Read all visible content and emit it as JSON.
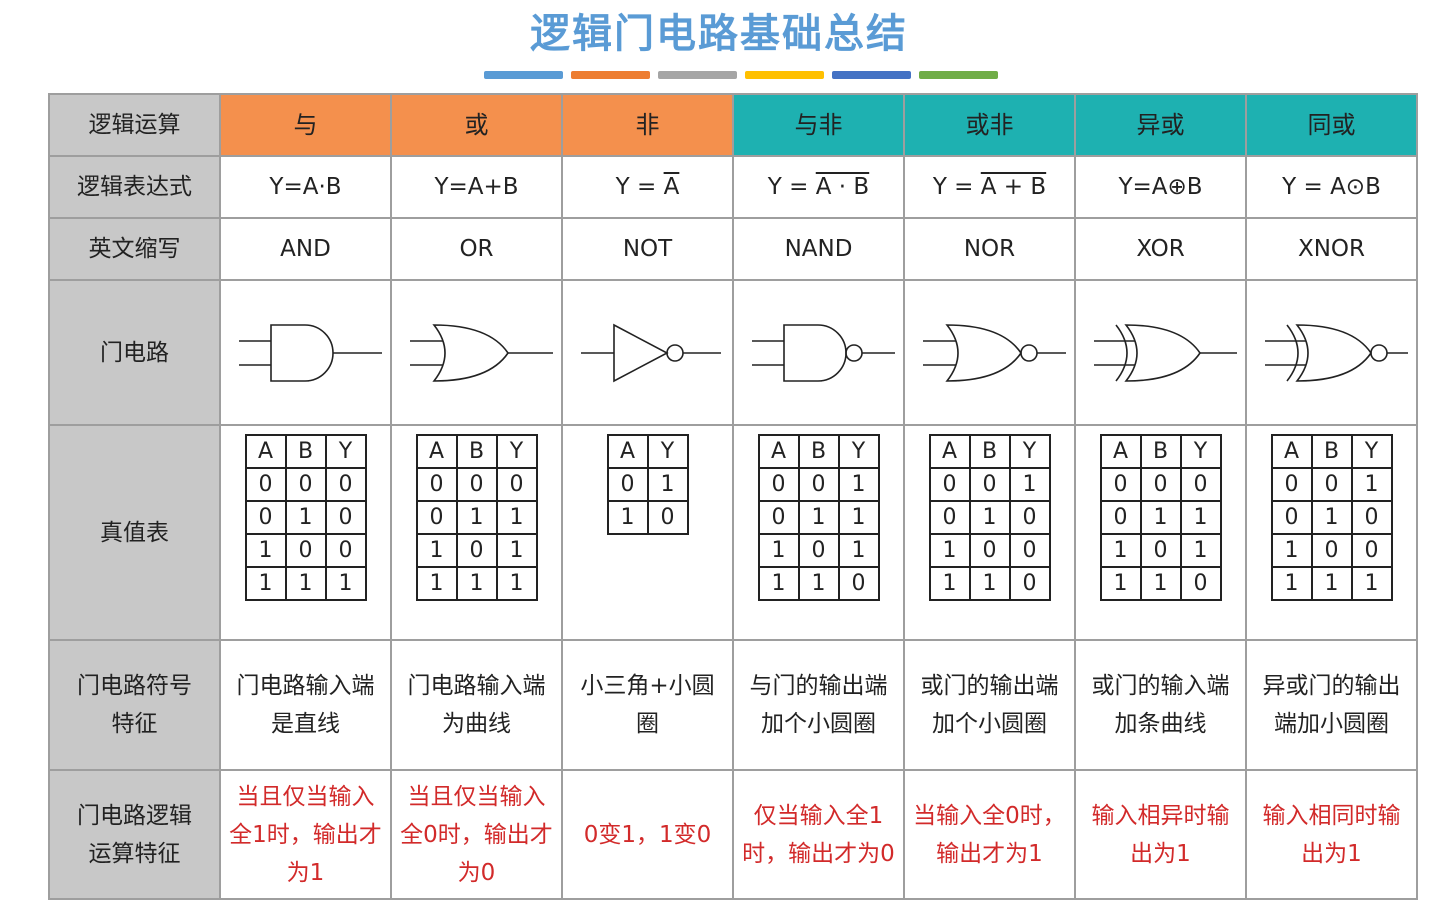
{
  "title": "逻辑门电路基础总结",
  "title_bar_colors": [
    "#5a9bd5",
    "#ed7d31",
    "#a5a5a5",
    "#ffc000",
    "#4472c4",
    "#70ad47"
  ],
  "header_colors": {
    "orange": "#f4904d",
    "teal": "#1eb1b1",
    "rowhead": "#c8c8c8",
    "red": "#d22a2a"
  },
  "row_labels": {
    "op": "逻辑运算",
    "expr": "逻辑表达式",
    "abbr": "英文缩写",
    "gate": "门电路",
    "truth": "真值表",
    "symbol_line1": "门电路符号",
    "symbol_line2": "特征",
    "logic_line1": "门电路逻辑",
    "logic_line2": "运算特征"
  },
  "gates": [
    {
      "op": "与",
      "expr": "Y=A·B",
      "abbr": "AND",
      "gate_icon": "and-gate-icon",
      "tt_head": [
        "A",
        "B",
        "Y"
      ],
      "tt_rows": [
        [
          "0",
          "0",
          "0"
        ],
        [
          "0",
          "1",
          "0"
        ],
        [
          "1",
          "0",
          "0"
        ],
        [
          "1",
          "1",
          "1"
        ]
      ],
      "symbol": "门电路输入端是直线",
      "logic": "当且仅当输入全1时，输出才为1"
    },
    {
      "op": "或",
      "expr": "Y=A+B",
      "abbr": "OR",
      "gate_icon": "or-gate-icon",
      "tt_head": [
        "A",
        "B",
        "Y"
      ],
      "tt_rows": [
        [
          "0",
          "0",
          "0"
        ],
        [
          "0",
          "1",
          "1"
        ],
        [
          "1",
          "0",
          "1"
        ],
        [
          "1",
          "1",
          "1"
        ]
      ],
      "symbol": "门电路输入端为曲线",
      "logic": "当且仅当输入全0时，输出才为0"
    },
    {
      "op": "非",
      "expr_pre": "Y = ",
      "expr_over": "A",
      "abbr": "NOT",
      "gate_icon": "not-gate-icon",
      "tt_head": [
        "A",
        "Y"
      ],
      "tt_rows": [
        [
          "0",
          "1"
        ],
        [
          "1",
          "0"
        ]
      ],
      "symbol": "小三角+小圆圈",
      "logic": "0变1，1变0"
    },
    {
      "op": "与非",
      "expr_pre": "Y = ",
      "expr_over": "A · B",
      "abbr": "NAND",
      "gate_icon": "nand-gate-icon",
      "tt_head": [
        "A",
        "B",
        "Y"
      ],
      "tt_rows": [
        [
          "0",
          "0",
          "1"
        ],
        [
          "0",
          "1",
          "1"
        ],
        [
          "1",
          "0",
          "1"
        ],
        [
          "1",
          "1",
          "0"
        ]
      ],
      "symbol": "与门的输出端加个小圆圈",
      "logic": "仅当输入全1时，输出才为0"
    },
    {
      "op": "或非",
      "expr_pre": "Y = ",
      "expr_over": "A + B",
      "abbr": "NOR",
      "gate_icon": "nor-gate-icon",
      "tt_head": [
        "A",
        "B",
        "Y"
      ],
      "tt_rows": [
        [
          "0",
          "0",
          "1"
        ],
        [
          "0",
          "1",
          "0"
        ],
        [
          "1",
          "0",
          "0"
        ],
        [
          "1",
          "1",
          "0"
        ]
      ],
      "symbol": "或门的输出端加个小圆圈",
      "logic": "当输入全0时，输出才为1"
    },
    {
      "op": "异或",
      "expr": "Y=A⊕B",
      "abbr": "XOR",
      "gate_icon": "xor-gate-icon",
      "tt_head": [
        "A",
        "B",
        "Y"
      ],
      "tt_rows": [
        [
          "0",
          "0",
          "0"
        ],
        [
          "0",
          "1",
          "1"
        ],
        [
          "1",
          "0",
          "1"
        ],
        [
          "1",
          "1",
          "0"
        ]
      ],
      "symbol": "或门的输入端加条曲线",
      "logic": "输入相异时输出为1"
    },
    {
      "op": "同或",
      "expr": "Y = A⊙B",
      "abbr": "XNOR",
      "gate_icon": "xnor-gate-icon",
      "tt_head": [
        "A",
        "B",
        "Y"
      ],
      "tt_rows": [
        [
          "0",
          "0",
          "1"
        ],
        [
          "0",
          "1",
          "0"
        ],
        [
          "1",
          "0",
          "0"
        ],
        [
          "1",
          "1",
          "1"
        ]
      ],
      "symbol": "异或门的输出端加小圆圈",
      "logic": "输入相同时输出为1"
    }
  ]
}
